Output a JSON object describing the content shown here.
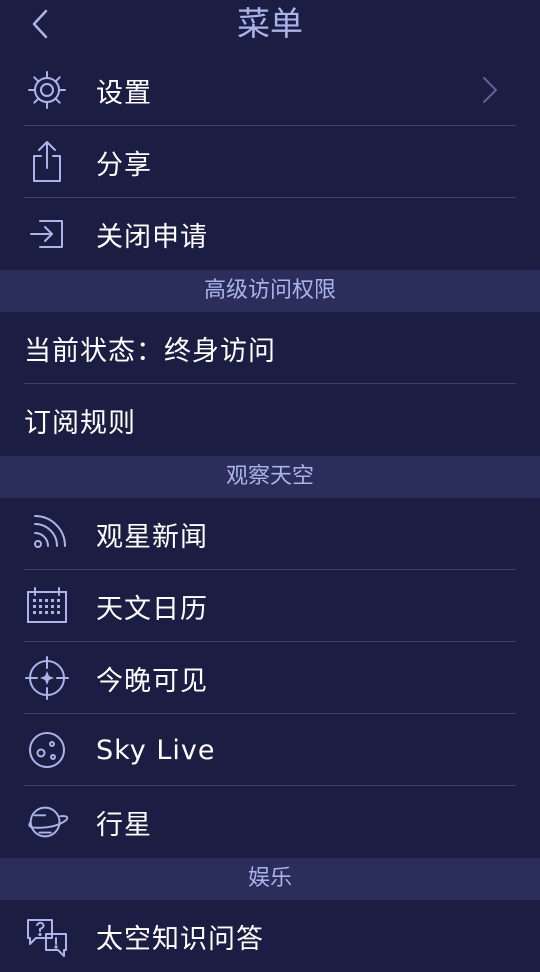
{
  "header": {
    "title": "菜单"
  },
  "menu": {
    "settings": "设置",
    "share": "分享",
    "close_app": "关闭申请"
  },
  "sections": {
    "premium": "高级访问权限",
    "observe": "观察天空",
    "entertainment": "娱乐"
  },
  "premium": {
    "status": "当前状态：终身访问",
    "rules": "订阅规则"
  },
  "observe": {
    "news": "观星新闻",
    "calendar": "天文日历",
    "tonight": "今晚可见",
    "sky_live": "Sky Live",
    "planets": "行星"
  },
  "entertainment": {
    "quiz": "太空知识问答"
  },
  "colors": {
    "background": "#1c1d43",
    "section_bg": "#2b2d5a",
    "accent": "#aab4ea",
    "divider": "#3e4070"
  }
}
